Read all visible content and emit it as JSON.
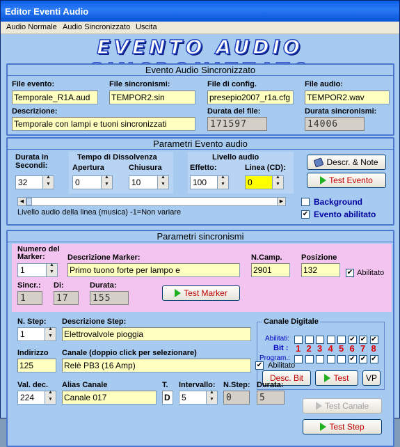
{
  "window": {
    "title": "Editor Eventi Audio"
  },
  "menu": [
    "Audio Normale",
    "Audio Sincronizzato",
    "Uscita"
  ],
  "banner": "EVENTO AUDIO SINCRONIZZATO",
  "section1": {
    "title": "Evento Audio Sincronizzato",
    "file_evento_label": "File evento:",
    "file_evento": "Temporale_R1A.aud",
    "file_sinc_label": "File sincronismi:",
    "file_sinc": "TEMPOR2.sin",
    "file_config_label": "File di config.",
    "file_config": "presepio2007_r1a.cfg",
    "file_audio_label": "File audio:",
    "file_audio": "TEMPOR2.wav",
    "descr_label": "Descrizione:",
    "descr": "Temporale con lampi e tuoni sincronizzati",
    "durata_file_label": "Durata del file:",
    "durata_file": "171597",
    "durata_sinc_label": "Durata sincronismi:",
    "durata_sinc": "14006"
  },
  "section2": {
    "title": "Parametri Evento audio",
    "durata_label1": "Durata in",
    "durata_label2": "Secondi:",
    "durata": "32",
    "dissolvenza_label": "Tempo di Dissolvenza",
    "apertura_label": "Apertura",
    "apertura": "0",
    "chiusura_label": "Chiusura",
    "chiusura": "10",
    "livello_label": "Livello audio",
    "effetto_label": "Effetto:",
    "effetto": "100",
    "linea_label": "Linea (CD):",
    "linea": "0",
    "descr_note_btn": "Descr. & Note",
    "test_evento_btn": "Test Evento",
    "slider_caption": "Livello audio della linea (musica) -1=Non variare",
    "background_label": "Background",
    "abilitato_label": "Evento abilitato",
    "background_checked": false,
    "abilitato_checked": true
  },
  "section3": {
    "title": "Parametri sincronismi",
    "num_marker_label1": "Numero del",
    "num_marker_label2": "Marker:",
    "num_marker": "1",
    "descr_marker_label": "Descrizione Marker:",
    "descr_marker": "Primo tuono forte per lampo e",
    "ncamp_label": "N.Camp.",
    "ncamp": "2901",
    "posizione_label": "Posizione",
    "posizione": "132",
    "marker_abilitato": "Abilitato",
    "sincr_label": "Sincr.:",
    "sincr": "1",
    "di_label": "Di:",
    "di": "17",
    "durata_label": "Durata:",
    "durata": "155",
    "test_marker_btn": "Test Marker",
    "canale_digitale_title": "Canale Digitale",
    "abilitati_label": "Abilitati:",
    "bit_label": "Bit :",
    "program_label": "Program.:",
    "bits": [
      "1",
      "2",
      "3",
      "4",
      "5",
      "6",
      "7",
      "8"
    ],
    "abilitati": [
      false,
      false,
      false,
      false,
      false,
      true,
      true,
      true
    ],
    "program": [
      false,
      false,
      false,
      false,
      false,
      true,
      true,
      true
    ],
    "desc_bit_btn": "Desc. Bit",
    "test_btn": "Test",
    "vp_btn": "VP",
    "nstep_label": "N. Step:",
    "nstep": "1",
    "descr_step_label": "Descrizione Step:",
    "descr_step": "Elettrovalvole pioggia",
    "indirizzo_label": "Indirizzo",
    "indirizzo": "125",
    "canale_label": "Canale (doppio click per selezionare)",
    "canale": "Relè PB3 (16 Amp)",
    "canale_abilitato": "Abilitato",
    "valdec_label": "Val. dec.",
    "valdec": "224",
    "alias_label": "Alias Canale",
    "alias": "Canale 017",
    "t_label": "T.",
    "t": "D",
    "intervallo_label": "Intervallo:",
    "intervallo": "5",
    "nstep2_label": "N.Step:",
    "nstep2": "0",
    "durata2_label": "Durata:",
    "durata2": "5",
    "test_canale_btn": "Test Canale",
    "test_step_btn": "Test Step"
  }
}
